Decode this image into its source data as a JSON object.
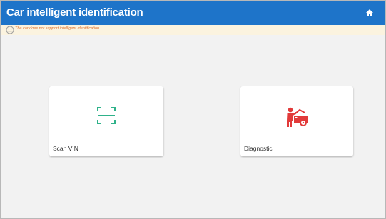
{
  "header": {
    "title": "Car intelligent identification",
    "home_icon": "home-icon",
    "color": "#1e74c9"
  },
  "notice": {
    "icon": "sad-face-icon",
    "text": "The car does not support intelligent identification",
    "color": "#e0702a"
  },
  "cards": [
    {
      "label": "Scan VIN",
      "icon": "scan-frame-icon",
      "icon_color": "#2fb28a"
    },
    {
      "label": "Diagnostic",
      "icon": "mechanic-car-icon",
      "icon_color": "#e23a3a"
    }
  ]
}
